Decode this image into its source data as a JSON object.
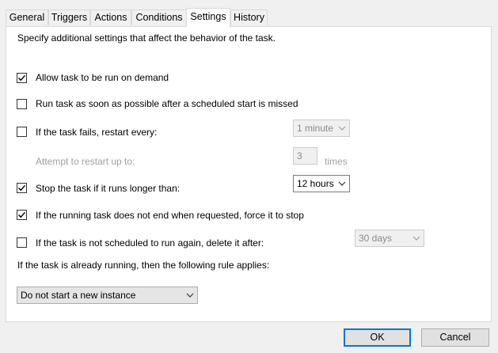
{
  "tabs": [
    {
      "label": "General"
    },
    {
      "label": "Triggers"
    },
    {
      "label": "Actions"
    },
    {
      "label": "Conditions"
    },
    {
      "label": "Settings",
      "active": true
    },
    {
      "label": "History"
    }
  ],
  "settings": {
    "intro": "Specify additional settings that affect the behavior of the task.",
    "allow_on_demand": {
      "label": "Allow task to be run on demand",
      "checked": true
    },
    "run_asap": {
      "label": "Run task as soon as possible after a scheduled start is missed",
      "checked": false
    },
    "restart_on_fail": {
      "label": "If the task fails, restart every:",
      "checked": false,
      "interval": "1 minute"
    },
    "restart_attempts": {
      "label": "Attempt to restart up to:",
      "value": "3",
      "unit": "times"
    },
    "stop_if_longer": {
      "label": "Stop the task if it runs longer than:",
      "checked": true,
      "duration": "12 hours"
    },
    "force_stop": {
      "label": "If the running task does not end when requested, force it to stop",
      "checked": true
    },
    "delete_if_not_scheduled": {
      "label": "If the task is not scheduled to run again, delete it after:",
      "checked": false,
      "delay": "30 days"
    },
    "running_rule_label": "If the task is already running, then the following rule applies:",
    "running_rule_value": "Do not start a new instance"
  },
  "buttons": {
    "ok": "OK",
    "cancel": "Cancel"
  },
  "colors": {
    "accent": "#0078d7",
    "disabled_text": "#a0a0a0"
  }
}
